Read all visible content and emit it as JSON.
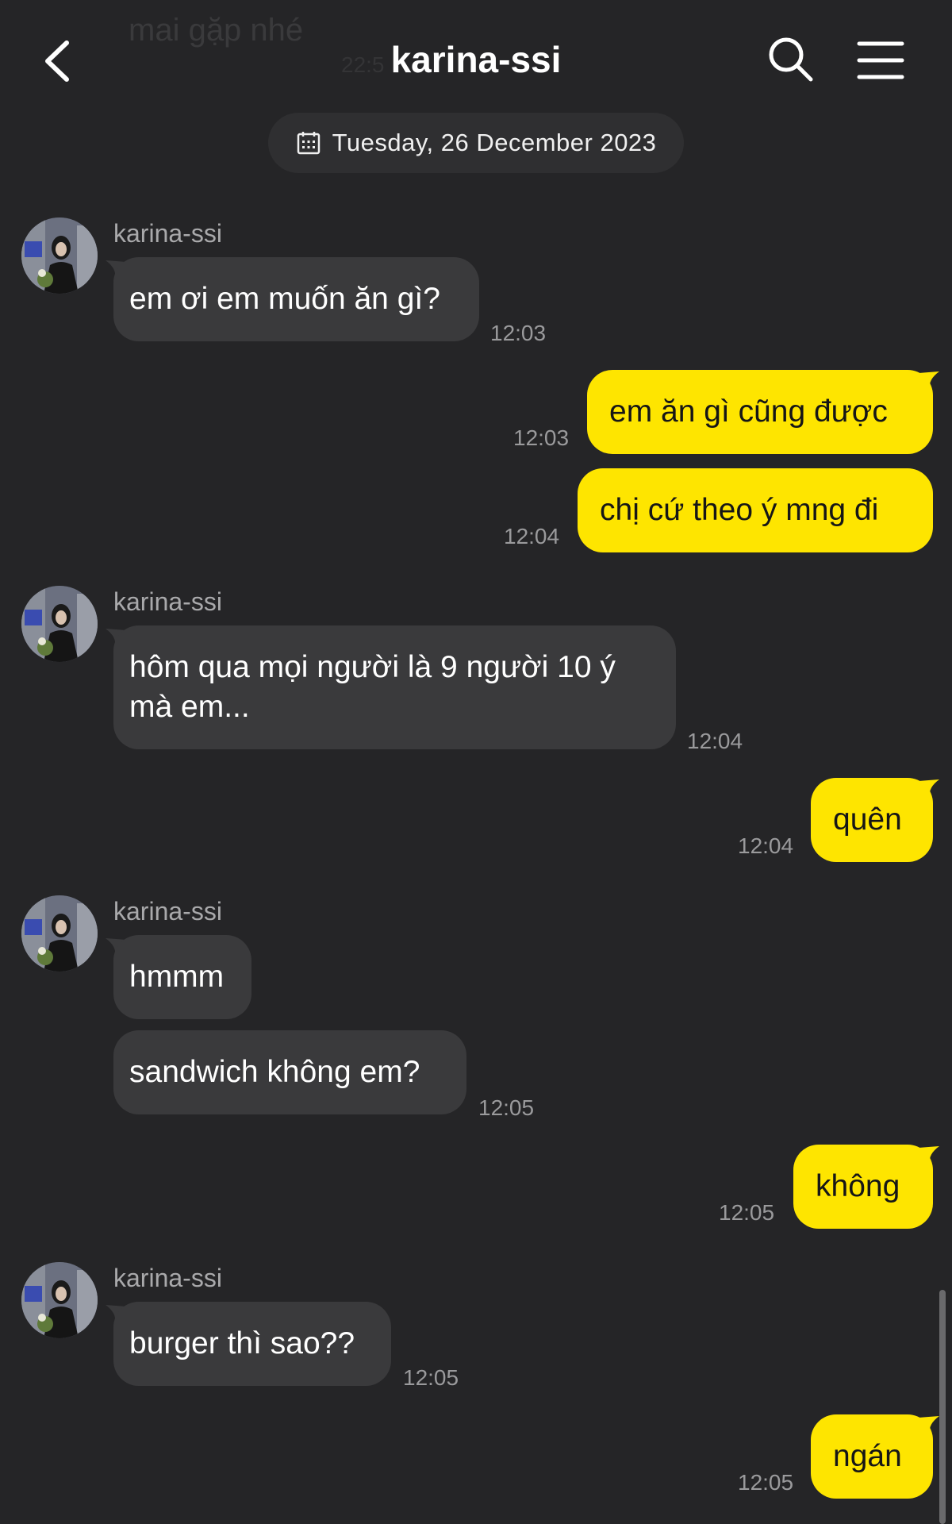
{
  "header": {
    "title": "karina-ssi",
    "back_icon": "chevron-left-icon",
    "search_icon": "search-icon",
    "menu_icon": "hamburger-menu-icon"
  },
  "previous_message": {
    "text": "mai gặp nhé",
    "time": "22:5"
  },
  "date_divider": {
    "label": "Tuesday, 26 December 2023",
    "icon": "calendar-icon"
  },
  "colors": {
    "background": "#252527",
    "incoming_bubble": "#3a3a3c",
    "outgoing_bubble": "#fee500"
  },
  "messages": [
    {
      "sender": "karina-ssi",
      "text": "em ơi em muốn ăn gì?",
      "time": "12:03"
    },
    {
      "text": "em ăn gì cũng được",
      "time": "12:03"
    },
    {
      "text": "chị cứ theo ý mng đi",
      "time": "12:04"
    },
    {
      "sender": "karina-ssi",
      "text_line1": "hôm qua mọi người là 9 người 10 ý",
      "text_line2": "mà em...",
      "time": "12:04"
    },
    {
      "text": "quên",
      "time": "12:04"
    },
    {
      "sender": "karina-ssi",
      "text": "hmmm"
    },
    {
      "text": "sandwich không em?",
      "time": "12:05"
    },
    {
      "text": "không",
      "time": "12:05"
    },
    {
      "sender": "karina-ssi",
      "text": "burger thì sao??",
      "time": "12:05"
    },
    {
      "text": "ngán",
      "time": "12:05"
    }
  ]
}
